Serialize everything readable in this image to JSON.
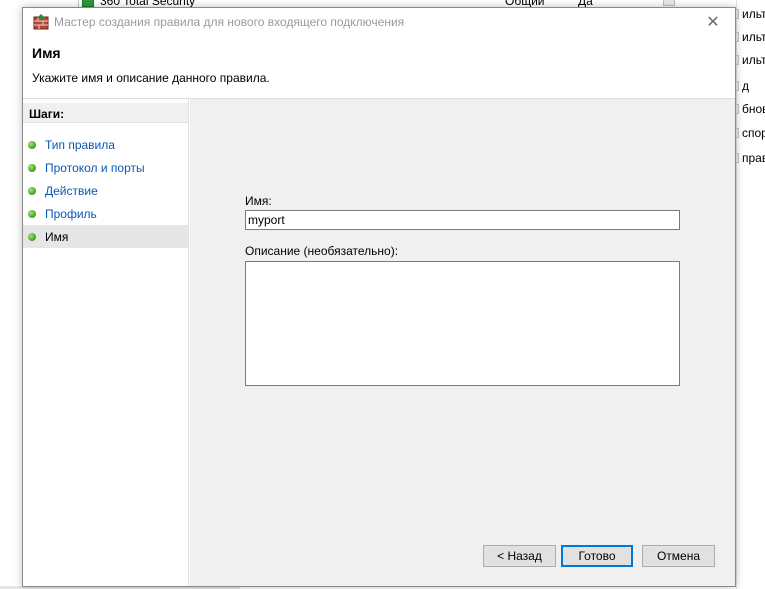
{
  "background": {
    "rule_row": {
      "name": "360 Total Security",
      "profile": "Общий",
      "enabled": "Да"
    },
    "actions": [
      {
        "label": "ильтр"
      },
      {
        "label": "ильтр"
      },
      {
        "label": "ильтр"
      },
      {
        "label": "д"
      },
      {
        "label": "бнови"
      },
      {
        "label": "спорт"
      },
      {
        "label": "правка"
      }
    ]
  },
  "dialog": {
    "title": "Мастер создания правила для нового входящего подключения",
    "close_glyph": "✕",
    "page_title": "Имя",
    "page_description": "Укажите имя и описание данного правила.",
    "steps_header": "Шаги:",
    "steps": [
      {
        "label": "Тип правила"
      },
      {
        "label": "Протокол и порты"
      },
      {
        "label": "Действие"
      },
      {
        "label": "Профиль"
      },
      {
        "label": "Имя"
      }
    ],
    "current_step": "Имя",
    "name_label": "Имя:",
    "name_value": "myport",
    "description_label": "Описание (необязательно):",
    "description_value": "",
    "buttons": {
      "back": "< Назад",
      "finish": "Готово",
      "cancel": "Отмена"
    }
  },
  "colors": {
    "link": "#0b57b5",
    "content_bg": "#f0f0f0",
    "step_dot": "#4aa927",
    "default_button_border": "#0078d7"
  }
}
